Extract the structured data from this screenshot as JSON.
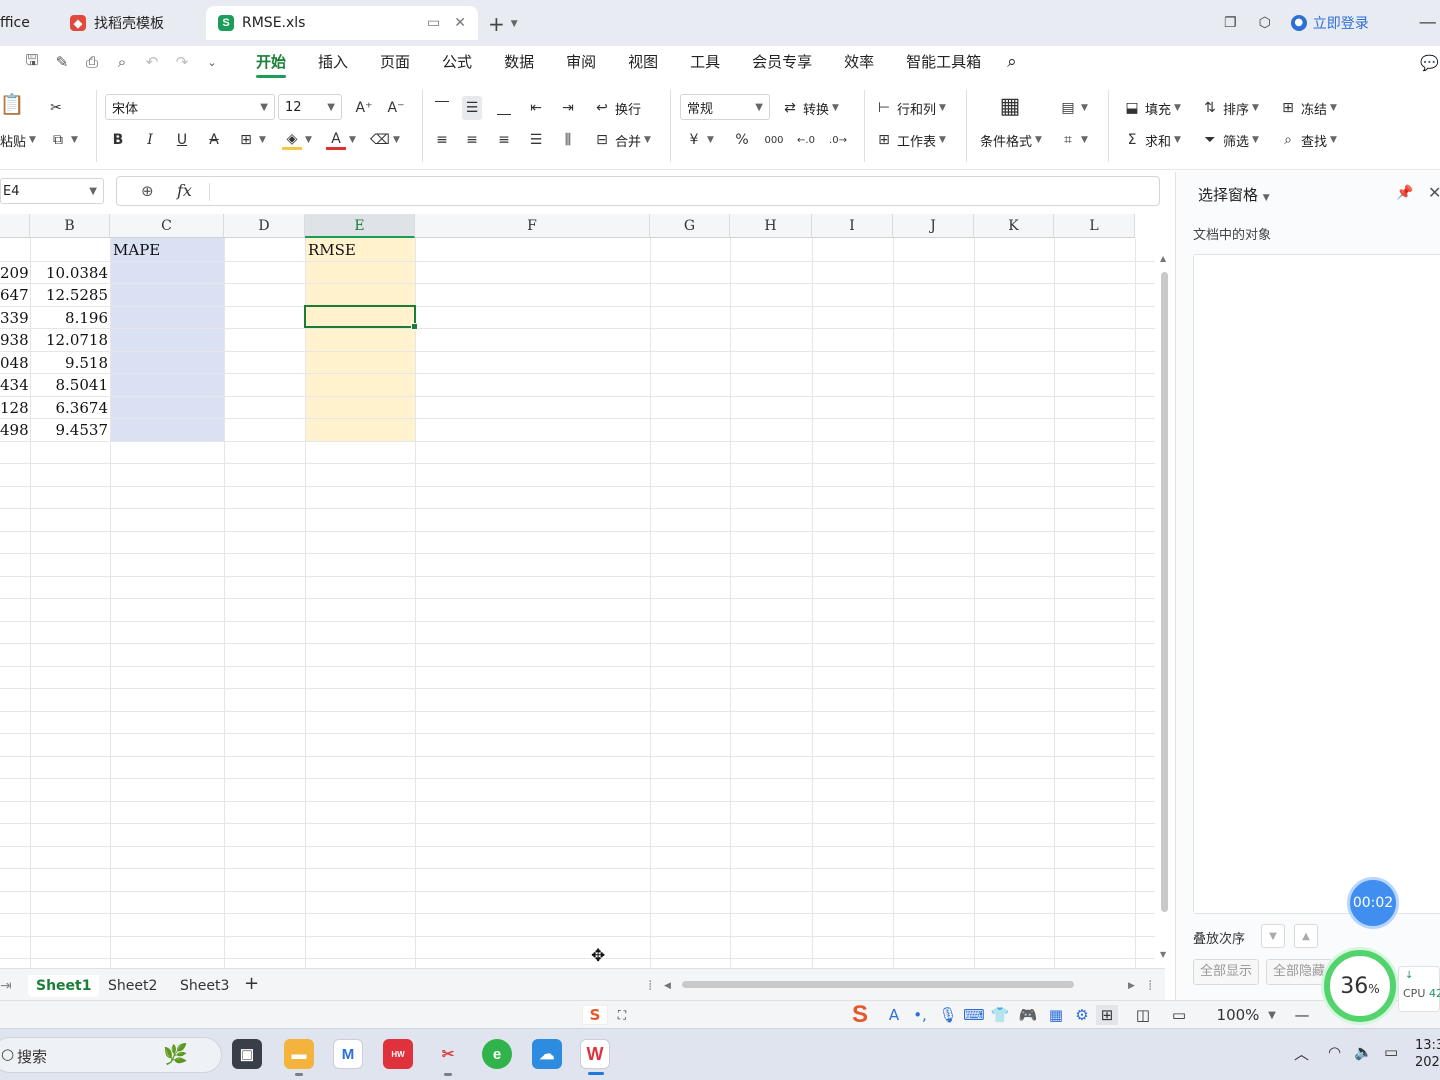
{
  "window": {
    "tabs": [
      {
        "label": "ffice",
        "icon": "office-home-icon"
      },
      {
        "label": "找稻壳模板",
        "icon": "docer-icon"
      },
      {
        "label": "RMSE.xls",
        "icon": "spreadsheet-icon",
        "icon_letter": "S"
      }
    ],
    "login_label": "立即登录",
    "accent": "#1a9c5a"
  },
  "menu": {
    "items": [
      "开始",
      "插入",
      "页面",
      "公式",
      "数据",
      "审阅",
      "视图",
      "工具",
      "会员专享",
      "效率",
      "智能工具箱"
    ],
    "active": "开始"
  },
  "toolbar": {
    "paste": "粘贴",
    "font_name": "宋体",
    "font_size": "12",
    "bold": "B",
    "italic": "I",
    "underline": "U",
    "wrap": "换行",
    "merge": "合并",
    "number_format": "常规",
    "convert": "转换",
    "row_col": "行和列",
    "worksheet": "工作表",
    "cond_format": "条件格式",
    "fill": "填充",
    "sort": "排序",
    "freeze": "冻结",
    "sum": "求和",
    "filter": "筛选",
    "find": "查找",
    "currency_symbol": "¥",
    "percent_symbol": "%",
    "thousands_symbol": "000"
  },
  "formula_bar": {
    "cell_ref": "E4",
    "fx_label": "fx",
    "content": ""
  },
  "sheet": {
    "columns": [
      "B",
      "C",
      "D",
      "E",
      "F",
      "G",
      "H",
      "I",
      "J",
      "K",
      "L"
    ],
    "selected_column": "E",
    "selected_cell": "E4",
    "col_a_partial": [
      "209",
      "647",
      "339",
      "938",
      "048",
      "434",
      "128",
      "498"
    ],
    "col_b": [
      "10.0384",
      "12.5285",
      "8.196",
      "12.0718",
      "9.518",
      "8.5041",
      "6.3674",
      "9.4537"
    ],
    "c1": "MAPE",
    "e1": "RMSE",
    "fill_c": "#d9e1f2",
    "fill_e": "#fff2cc"
  },
  "sheet_tabs": {
    "tabs": [
      "Sheet1",
      "Sheet2",
      "Sheet3"
    ],
    "active": "Sheet1",
    "add_label": "+"
  },
  "status": {
    "zoom": "100%"
  },
  "panel": {
    "title": "选择窗格",
    "subtitle": "文档中的对象",
    "order_label": "叠放次序",
    "show_all": "全部显示",
    "hide_all": "全部隐藏"
  },
  "overlay": {
    "timer": "00:02",
    "cpu_percent": "36",
    "cpu_percent_unit": "%",
    "cpu_label": "CPU",
    "cpu_value": "42"
  },
  "taskbar": {
    "search_label": "搜索",
    "time": "13:3",
    "date": "202"
  }
}
